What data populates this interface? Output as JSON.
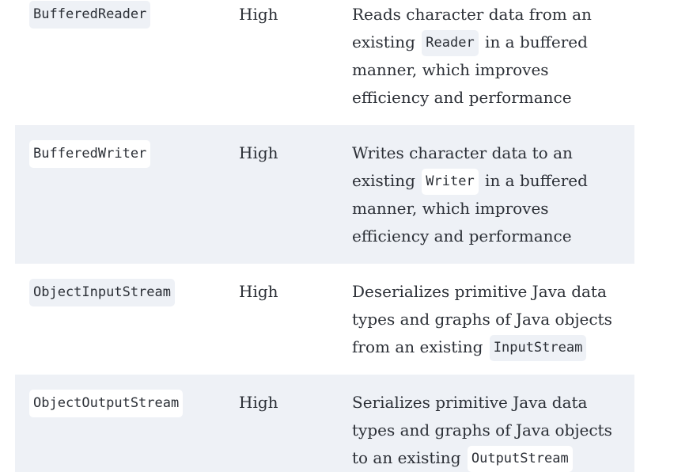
{
  "rows": [
    {
      "name": "BufferedReader",
      "rank": "High",
      "desc_before": "Reads character data from an existing",
      "desc_code": "Reader",
      "desc_after": "in a buffered manner, which improves efficiency and performance"
    },
    {
      "name": "BufferedWriter",
      "rank": "High",
      "desc_before": "Writes character data to an existing",
      "desc_code": "Writer",
      "desc_after": "in a buffered manner, which improves efficiency and performance"
    },
    {
      "name": "ObjectInputStream",
      "rank": "High",
      "desc_before": "Deserializes primitive Java data types and graphs of Java objects from an existing",
      "desc_code": "InputStream",
      "desc_after": ""
    },
    {
      "name": "ObjectOutputStream",
      "rank": "High",
      "desc_before": "Serializes primitive Java data types and graphs of Java objects to an existing",
      "desc_code": "OutputStream",
      "desc_after": ""
    }
  ]
}
